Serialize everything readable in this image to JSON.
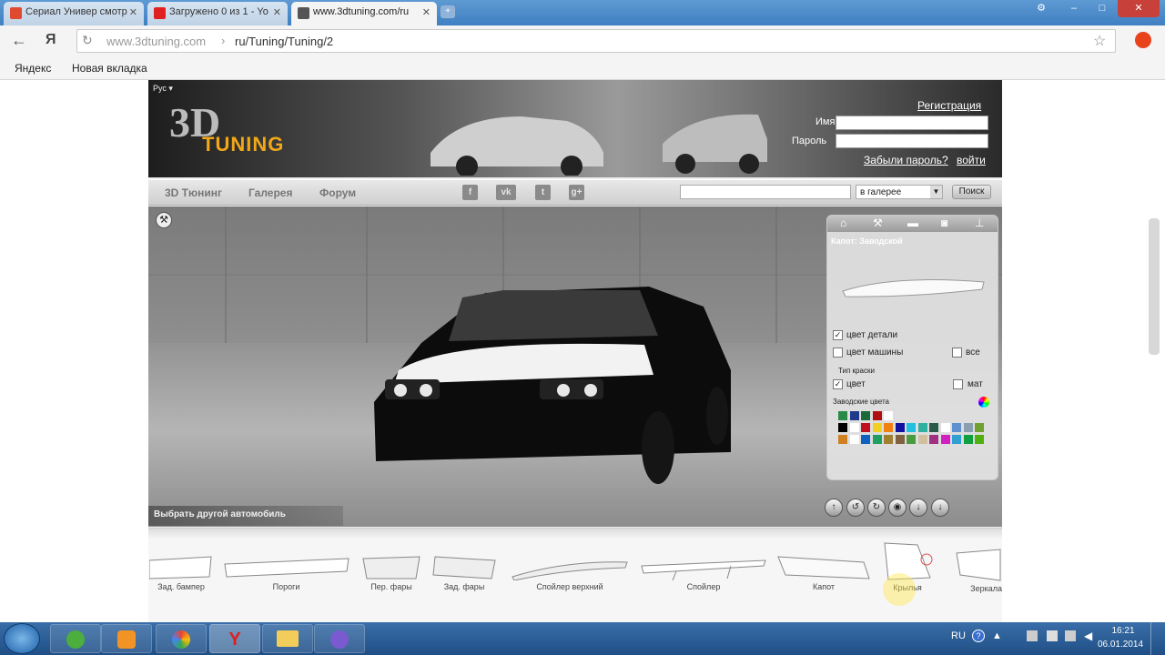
{
  "browser": {
    "tabs": [
      {
        "title": "Сериал Универ смотр",
        "color": "#e04a2e"
      },
      {
        "title": "Загружено 0 из 1 - Yo",
        "color": "#e02020"
      },
      {
        "title": "www.3dtuning.com/ru",
        "color": "#555555"
      }
    ],
    "address_host": "www.3dtuning.com",
    "address_sep": "›",
    "address_path": "ru/Tuning/Tuning/2",
    "yandex_label": "Я",
    "bookmarks": [
      "Яндекс",
      "Новая вкладка"
    ]
  },
  "site": {
    "lang": "Рус",
    "logo_3d": "3D",
    "logo_tuning": "TUNING",
    "register_link": "Регистрация",
    "login_label": "Имя",
    "password_label": "Пароль",
    "forgot_link": "Забыли пароль?",
    "login_button": "войти",
    "menu": [
      "3D Тюнинг",
      "Галерея",
      "Форум"
    ],
    "social": [
      "f",
      "vk",
      "t",
      "g+"
    ],
    "search_scope": "в галерее",
    "search_button": "Поиск",
    "select_car": "Выбрать другой автомобиль"
  },
  "panel": {
    "tabs": [
      "home-icon",
      "tools-icon",
      "car-icon",
      "camera-icon",
      "tree-icon"
    ],
    "part_title": "Капот: Заводской",
    "opt_part_color": "цвет детали",
    "opt_car_color": "цвет машины",
    "opt_all": "все",
    "paint_type_label": "Тип краски",
    "opt_color": "цвет",
    "opt_mat": "мат",
    "factory_colors_label": "Заводские цвета",
    "checked": {
      "part_color": true,
      "car_color": false,
      "all": false,
      "color": true,
      "mat": false
    },
    "colors_row1": [
      "#2a8a4a",
      "#1f3a8a",
      "#1a6a3a",
      "#b01010",
      "#ffffff"
    ],
    "colors_row2": [
      "#000000",
      "#ffffff",
      "#c01020",
      "#f0d020",
      "#f08010",
      "#1010a0",
      "#20c0e0",
      "#30b0a0",
      "#2a5a4a",
      "#ffffff",
      "#6090d0",
      "#8aa0b0",
      "#70a030"
    ],
    "colors_row3": [
      "#d08020",
      "#ffffff",
      "#1060c0",
      "#20a060",
      "#a08030",
      "#806040",
      "#4a9a40",
      "#d0c0a0",
      "#a03080",
      "#d020c0",
      "#30a0d0",
      "#10a040",
      "#50b010"
    ]
  },
  "viewer_controls": [
    "arrow-up-icon",
    "rotate-left-icon",
    "rotate-right-icon",
    "camera-icon",
    "download-icon",
    "download-icon"
  ],
  "parts_strip": [
    "Зад. бампер",
    "Пороги",
    "Пер. фары",
    "Зад. фары",
    "Спойлер верхний",
    "Спойлер",
    "Капот",
    "Крылья",
    "Зеркала"
  ],
  "taskbar": {
    "lang": "RU",
    "time": "16:21",
    "date": "06.01.2014"
  }
}
